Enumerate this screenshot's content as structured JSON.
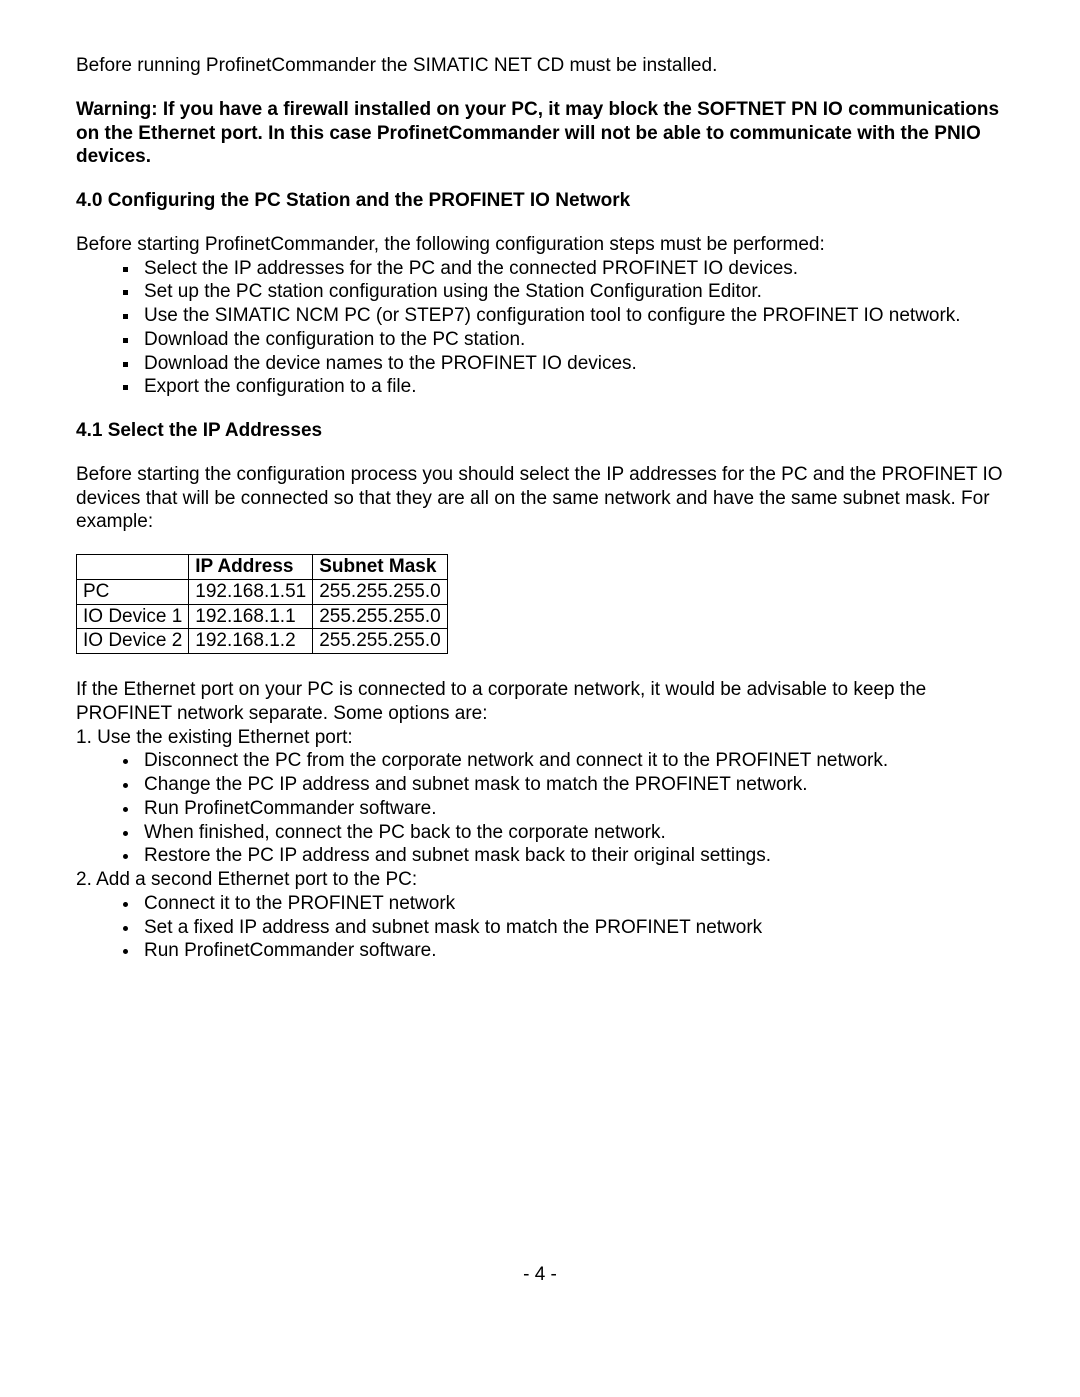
{
  "intro": "Before running ProfinetCommander the SIMATIC NET CD must be installed.",
  "warning": "Warning: If you have a firewall installed on your PC, it may block the SOFTNET PN IO communications on the Ethernet port. In this case ProfinetCommander will not be able to communicate with the PNIO devices.",
  "sec4_0_heading": "4.0 Configuring the PC Station and the PROFINET IO Network",
  "sec4_0_intro": "Before starting ProfinetCommander, the following configuration steps must be performed:",
  "sec4_0_bullets": [
    "Select the IP addresses for the PC and the connected PROFINET IO devices.",
    "Set up the PC station configuration using the Station Configuration Editor.",
    "Use the SIMATIC NCM PC (or STEP7) configuration tool to configure the PROFINET IO network.",
    "Download the configuration to the PC station.",
    "Download the device names to the PROFINET IO devices.",
    "Export the configuration to a file."
  ],
  "sec4_1_heading": "4.1  Select the IP Addresses",
  "sec4_1_intro": "Before starting the configuration process you should select the IP addresses for the PC and the PROFINET IO devices that will be connected so that they are all on the same network and have the same subnet mask. For example:",
  "table": {
    "headers": [
      "",
      "IP Address",
      "Subnet Mask"
    ],
    "rows": [
      [
        "PC",
        "192.168.1.51",
        "255.255.255.0"
      ],
      [
        "IO Device 1",
        "192.168.1.1",
        "255.255.255.0"
      ],
      [
        "IO Device 2",
        "192.168.1.2",
        "255.255.255.0"
      ]
    ]
  },
  "advice": "If the Ethernet port on your PC is connected to a corporate network, it would be advisable to keep the PROFINET network separate. Some options are:",
  "opt1_label": "1. Use the existing Ethernet port:",
  "opt1_bullets": [
    "Disconnect the PC from the corporate network and connect it to the PROFINET network.",
    "Change the PC IP address and subnet mask to match the PROFINET network.",
    "Run ProfinetCommander software.",
    "When finished, connect the PC back to the corporate network.",
    "Restore the PC IP address and subnet mask back to their original settings."
  ],
  "opt2_label": "2. Add a second Ethernet port to the PC:",
  "opt2_bullets": [
    "Connect it to the PROFINET network",
    "Set a fixed IP address and subnet mask to match the PROFINET network",
    "Run ProfinetCommander software."
  ],
  "page_number": "- 4 -"
}
